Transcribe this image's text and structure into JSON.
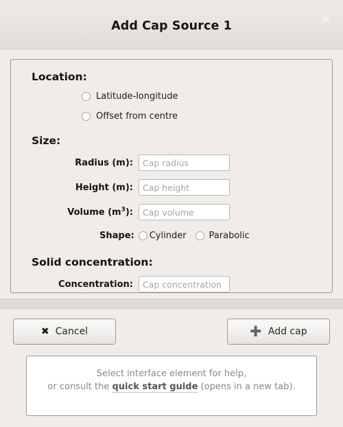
{
  "titlebar": {
    "title": "Add Cap Source 1",
    "close_icon": "close-icon",
    "close_glyph": "✕"
  },
  "form": {
    "location": {
      "heading": "Location:",
      "options": [
        {
          "label": "Latitude-longitude",
          "selected": false
        },
        {
          "label": "Offset from centre",
          "selected": false
        }
      ]
    },
    "size": {
      "heading": "Size:",
      "fields": [
        {
          "label": "Radius (m):",
          "placeholder": "Cap radius",
          "value": ""
        },
        {
          "label": "Height (m):",
          "placeholder": "Cap height",
          "value": ""
        }
      ],
      "volume_field": {
        "label_prefix": "Volume (m",
        "label_sup": "3",
        "label_suffix": "):",
        "placeholder": "Cap volume",
        "value": ""
      },
      "shape": {
        "label": "Shape:",
        "options": [
          {
            "label": "Cylinder",
            "selected": false
          },
          {
            "label": "Parabolic",
            "selected": false
          }
        ]
      }
    },
    "solid_concentration": {
      "heading": "Solid concentration:",
      "field": {
        "label": "Concentration:",
        "placeholder": "Cap concentration",
        "value": ""
      }
    }
  },
  "buttons": {
    "cancel": {
      "label": "Cancel",
      "icon": "cross-icon",
      "glyph": "✖"
    },
    "add_cap": {
      "label": "Add cap",
      "icon": "plus-icon",
      "glyph": "➕"
    }
  },
  "help": {
    "line1": "Select interface element for help,",
    "line2_before": "or consult the ",
    "line2_link": "quick start guide",
    "line2_after": " (opens in a new tab)."
  },
  "colors": {
    "dialog_bg": "#efecea",
    "titlebar_top": "#eceae7",
    "titlebar_bottom": "#dfdbd6",
    "panel_border": "#9d958b",
    "separator_band": "#dedad5",
    "input_border": "#bdb9b4",
    "placeholder_text": "#a8a49f",
    "help_text": "#8c8880"
  }
}
